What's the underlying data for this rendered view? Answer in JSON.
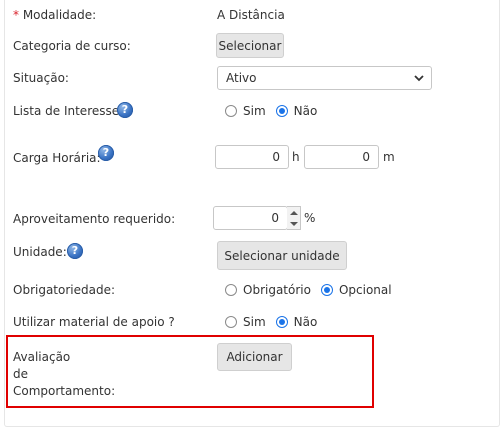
{
  "form": {
    "modalidade": {
      "required_mark": "*",
      "label": "Modalidade:",
      "value": "A Distância"
    },
    "categoria": {
      "label": "Categoria de curso:",
      "button": "Selecionar"
    },
    "situacao": {
      "label": "Situação:",
      "selected": "Ativo"
    },
    "interesse": {
      "label": "Lista de Interesse:",
      "help": "?",
      "options": [
        "Sim",
        "Não"
      ],
      "selected": "Não"
    },
    "carga": {
      "label": "Carga Horária:",
      "help": "?",
      "hours": "0",
      "hours_unit": "h",
      "minutes": "0",
      "minutes_unit": "m"
    },
    "aproveitamento": {
      "label": "Aproveitamento requerido:",
      "value": "0",
      "unit": "%"
    },
    "unidade": {
      "label": "Unidade:",
      "help": "?",
      "button": "Selecionar unidade"
    },
    "obrigatoriedade": {
      "label": "Obrigatoriedade:",
      "options": [
        "Obrigatório",
        "Opcional"
      ],
      "selected": "Opcional"
    },
    "material": {
      "label": "Utilizar material de apoio ?",
      "options": [
        "Sim",
        "Não"
      ],
      "selected": "Não"
    },
    "avaliacao": {
      "label_lines": [
        "Avaliação",
        "de",
        "Comportamento:"
      ],
      "button": "Adicionar"
    }
  },
  "colors": {
    "highlight": "#e00000",
    "radio_selected": "#1a73e8",
    "required": "#d9232c"
  }
}
